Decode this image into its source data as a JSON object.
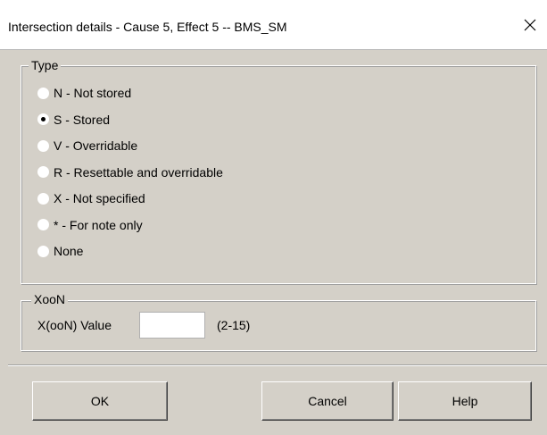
{
  "window": {
    "title": "Intersection details - Cause 5, Effect 5 -- BMS_SM",
    "close_icon": "close-icon"
  },
  "type_group": {
    "label": "Type",
    "options": [
      {
        "label": "N - Not stored",
        "selected": false
      },
      {
        "label": "S - Stored",
        "selected": true
      },
      {
        "label": "V - Overridable",
        "selected": false
      },
      {
        "label": "R - Resettable and overridable",
        "selected": false
      },
      {
        "label": "X - Not specified",
        "selected": false
      },
      {
        "label": "* - For note only",
        "selected": false
      },
      {
        "label": "None",
        "selected": false
      }
    ]
  },
  "xoon_group": {
    "label": "XooN",
    "field_label": "X(ooN) Value",
    "value": "",
    "range_hint": "(2-15)"
  },
  "buttons": {
    "ok": "OK",
    "cancel": "Cancel",
    "help": "Help"
  },
  "colors": {
    "dialog_bg": "#d4d0c8",
    "titlebar_bg": "#ffffff"
  }
}
